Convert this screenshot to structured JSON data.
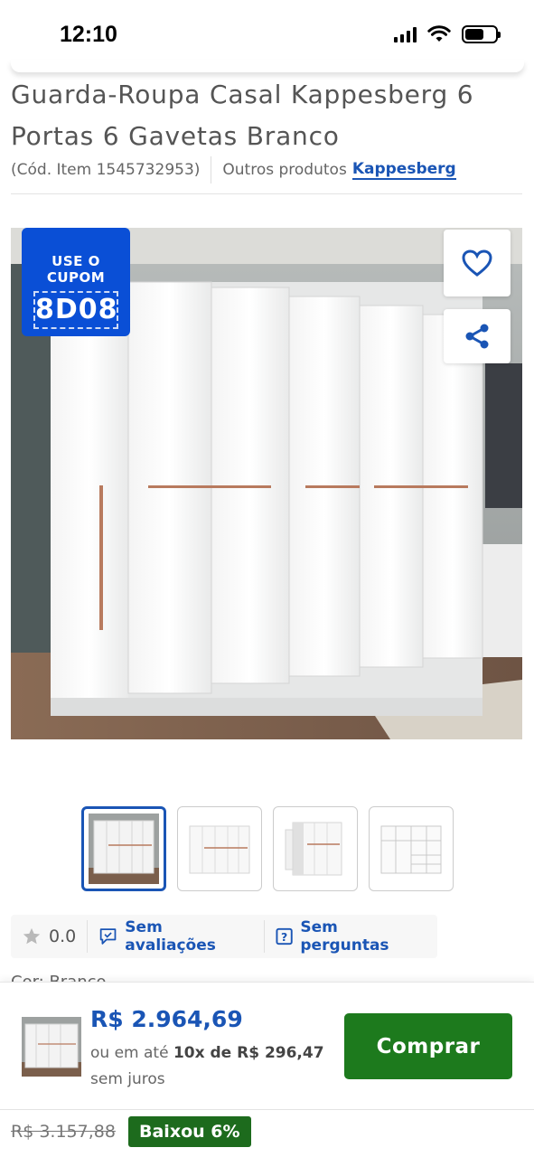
{
  "status_bar": {
    "time": "12:10"
  },
  "product": {
    "title": "Guarda-Roupa Casal Kappesberg 6 Portas 6 Gavetas Branco",
    "code": "(Cód. Item 1545732953)",
    "other_products_label": "Outros produtos",
    "brand": "Kappesberg"
  },
  "image": {
    "coupon_label": "USE O CUPOM",
    "coupon_code": "8D08",
    "favorite_icon": "heart-icon",
    "share_icon": "share-icon"
  },
  "thumbnails": [
    {
      "name": "front-closed",
      "active": true
    },
    {
      "name": "front-white",
      "active": false
    },
    {
      "name": "door-open",
      "active": false
    },
    {
      "name": "interior-diagram",
      "active": false
    }
  ],
  "rating": {
    "value": "0.0",
    "reviews_label": "Sem avaliações",
    "questions_label": "Sem perguntas"
  },
  "color_peek": "Cor: Branco",
  "buy": {
    "price": "R$ 2.964,69",
    "installment_prefix": "ou em até",
    "installment_bold": "10x de R$ 296,47",
    "installment_suffix": "sem juros",
    "button_label": "Comprar",
    "old_price": "R$ 3.157,88",
    "drop_badge": "Baixou 6%"
  },
  "colors": {
    "primary_blue": "#1a55b5",
    "coupon_blue": "#0a4fd6",
    "buy_green": "#1d7a1d",
    "badge_green": "#1d6b1d"
  }
}
